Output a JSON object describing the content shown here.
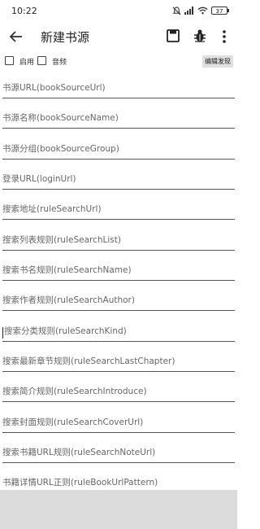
{
  "status_bar": {
    "time": "10:22",
    "battery": "37"
  },
  "app_bar": {
    "title": "新建书源"
  },
  "options": {
    "enable_label": "启用",
    "audio_label": "音频",
    "edit_discovery_label": "编辑发现"
  },
  "fields": [
    {
      "label": "书源URL(bookSourceUrl)"
    },
    {
      "label": "书源名称(bookSourceName)"
    },
    {
      "label": "书源分组(bookSourceGroup)"
    },
    {
      "label": "登录URL(loginUrl)"
    },
    {
      "label": "搜索地址(ruleSearchUrl)"
    },
    {
      "label": "搜索列表规则(ruleSearchList)"
    },
    {
      "label": "搜索书名规则(ruleSearchName)"
    },
    {
      "label": "搜索作者规则(ruleSearchAuthor)"
    },
    {
      "label": "搜索分类规则(ruleSearchKind)"
    },
    {
      "label": "搜索最新章节规则(ruleSearchLastChapter)"
    },
    {
      "label": "搜索简介规则(ruleSearchIntroduce)"
    },
    {
      "label": "搜索封面规则(ruleSearchCoverUrl)"
    },
    {
      "label": "搜索书籍URL规则(ruleSearchNoteUrl)"
    },
    {
      "label": "书籍详情URL正则(ruleBookUrlPattern)"
    }
  ]
}
